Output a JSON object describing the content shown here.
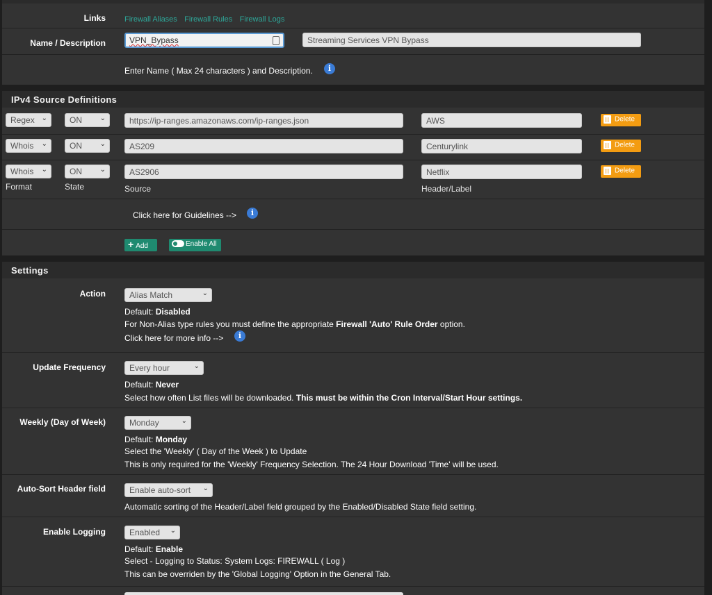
{
  "links": {
    "label": "Links",
    "items": [
      "Firewall Aliases",
      "Firewall Rules",
      "Firewall Logs"
    ]
  },
  "name_desc": {
    "label": "Name / Description",
    "name_value": "VPN_Bypass",
    "desc_value": "Streaming Services VPN Bypass",
    "help": "Enter Name ( Max 24 characters ) and Description."
  },
  "ipv4": {
    "title": "IPv4 Source Definitions",
    "rows": [
      {
        "format": "Regex",
        "state": "ON",
        "source": "https://ip-ranges.amazonaws.com/ip-ranges.json",
        "label": "AWS"
      },
      {
        "format": "Whois",
        "state": "ON",
        "source": "AS209",
        "label": "Centurylink"
      },
      {
        "format": "Whois",
        "state": "ON",
        "source": "AS2906",
        "label": "Netflix"
      }
    ],
    "delete_label": "Delete",
    "col_format": "Format",
    "col_state": "State",
    "col_source": "Source",
    "col_label": "Header/Label",
    "guidelines": "Click here for Guidelines -->",
    "add_label": "Add",
    "enable_all_label": "Enable All"
  },
  "settings": {
    "title": "Settings",
    "action": {
      "label": "Action",
      "value": "Alias Match",
      "default_prefix": "Default: ",
      "default_value": "Disabled",
      "help1_pre": "For Non-Alias type rules you must define the appropriate ",
      "help1_bold": "Firewall 'Auto' Rule Order",
      "help1_post": " option.",
      "more_info": "Click here for more info -->"
    },
    "update_freq": {
      "label": "Update Frequency",
      "value": "Every hour",
      "default_prefix": "Default: ",
      "default_value": "Never",
      "help_pre": "Select how often List files will be downloaded. ",
      "help_bold": "This must be within the Cron Interval/Start Hour settings."
    },
    "weekly": {
      "label": "Weekly (Day of Week)",
      "value": "Monday",
      "default_prefix": "Default: ",
      "default_value": "Monday",
      "help1": "Select the 'Weekly' ( Day of the Week ) to Update",
      "help2": "This is only required for the 'Weekly' Frequency Selection. The 24 Hour Download 'Time' will be used."
    },
    "autosort": {
      "label": "Auto-Sort Header field",
      "value": "Enable auto-sort",
      "help": "Automatic sorting of the Header/Label field grouped by the Enabled/Disabled State field setting."
    },
    "logging": {
      "label": "Enable Logging",
      "value": "Enabled",
      "default_prefix": "Default: ",
      "default_value": "Enable",
      "help1": "Select - Logging to Status: System Logs: FIREWALL ( Log )",
      "help2": "This can be overriden by the 'Global Logging' Option in the General Tab."
    }
  }
}
